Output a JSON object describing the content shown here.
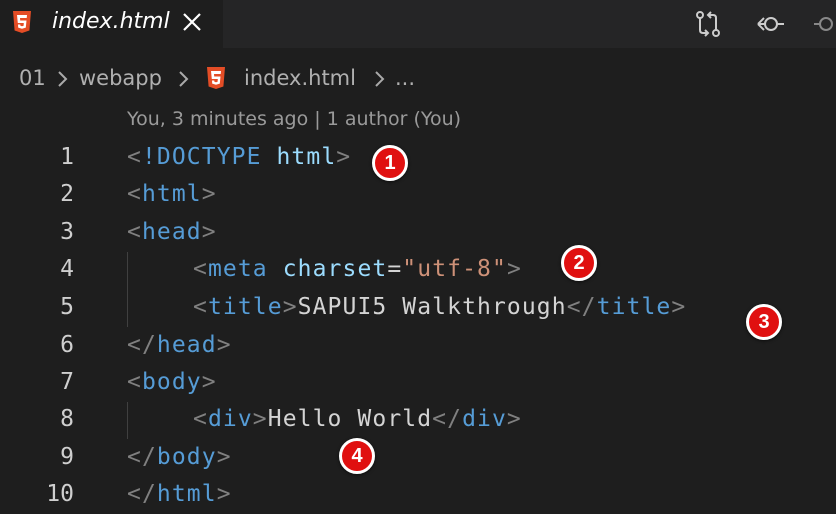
{
  "tab": {
    "label": "index.html",
    "icon": "html5-icon"
  },
  "actions": {
    "compare": "source-control-compare-icon",
    "back": "go-back-icon",
    "forward": "go-forward-icon"
  },
  "breadcrumb": [
    "01",
    "webapp",
    "index.html",
    "..."
  ],
  "codelens": "You, 3 minutes ago | 1 author (You)",
  "lines": [
    {
      "n": "1",
      "parts": [
        "<",
        "!DOCTYPE",
        " ",
        "html",
        ">"
      ]
    },
    {
      "n": "2",
      "parts": [
        "<",
        "html",
        ">"
      ]
    },
    {
      "n": "3",
      "parts": [
        "<",
        "head",
        ">"
      ]
    },
    {
      "n": "4",
      "parts": [
        "<",
        "meta",
        " ",
        "charset",
        "=",
        "\"utf-8\"",
        ">"
      ]
    },
    {
      "n": "5",
      "parts": [
        "<",
        "title",
        ">",
        "SAPUI5 Walkthrough",
        "</",
        "title",
        ">"
      ]
    },
    {
      "n": "6",
      "parts": [
        "</",
        "head",
        ">"
      ]
    },
    {
      "n": "7",
      "parts": [
        "<",
        "body",
        ">"
      ]
    },
    {
      "n": "8",
      "parts": [
        "<",
        "div",
        ">",
        "Hello World",
        "</",
        "div",
        ">"
      ]
    },
    {
      "n": "9",
      "parts": [
        "</",
        "body",
        ">"
      ]
    },
    {
      "n": "10",
      "parts": [
        "</",
        "html",
        ">"
      ]
    }
  ],
  "badges": [
    "1",
    "2",
    "3",
    "4"
  ],
  "colors": {
    "background": "#1e1e1e",
    "tag": "#569cd6",
    "attribute": "#9cdcfe",
    "string": "#ce9178",
    "text": "#d4d4d4",
    "punctuation": "#808080",
    "badge": "#e01010"
  }
}
